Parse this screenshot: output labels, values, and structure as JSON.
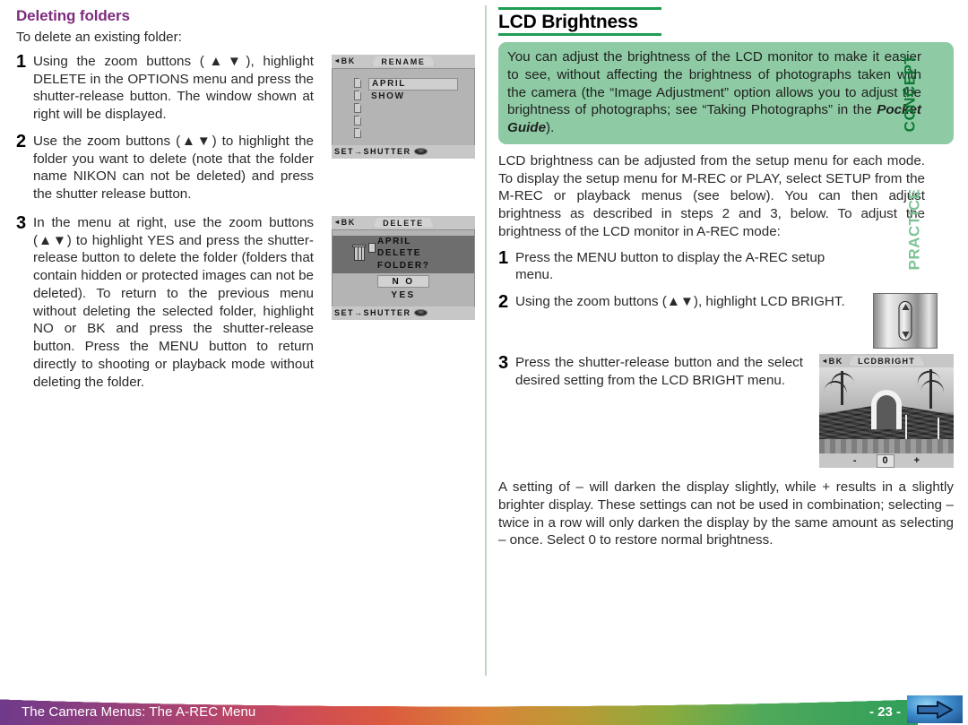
{
  "left_column": {
    "heading": "Deleting folders",
    "intro": "To delete an existing folder:",
    "steps": [
      {
        "num": "1",
        "text": "Using the zoom buttons (▲▼), highlight DELETE in the OPTIONS menu and press the shutter-release button. The window shown at right will be displayed."
      },
      {
        "num": "2",
        "text": "Use the zoom buttons (▲▼) to highlight the folder you want to delete (note that the folder name NIKON can not be deleted) and press the shutter release button."
      },
      {
        "num": "3",
        "text": "In the menu at right, use the zoom buttons (▲▼) to highlight YES and press the shutter-release button to delete the folder (folders that contain hidden or protected images can not be deleted). To return to the previous menu without deleting the selected folder, highlight NO or BK and press the shutter-release button. Press the MENU button to return directly to shooting or playback mode without deleting the folder."
      }
    ]
  },
  "lcd_rename": {
    "bk_label": "BK",
    "tab_title": "RENAME",
    "items": [
      {
        "label": "APRIL",
        "selected": true
      },
      {
        "label": "SHOW",
        "selected": false
      }
    ],
    "folder_icon_count": 5,
    "footer_label": "SET→SHUTTER"
  },
  "lcd_delete": {
    "bk_label": "BK",
    "tab_title": "DELETE",
    "confirm_lines": [
      "APRIL",
      "DELETE",
      "FOLDER?"
    ],
    "options": [
      {
        "label": "N O",
        "selected": true
      },
      {
        "label": "YES",
        "selected": false
      }
    ],
    "footer_label": "SET→SHUTTER"
  },
  "right_column": {
    "heading": "LCD Brightness",
    "concept_box": {
      "tab_label": "CONCEPT",
      "text": "You can adjust the brightness of the LCD monitor to make it easier to see, without affecting the brightness of photographs taken with the camera (the “Image Adjustment” option allows you to adjust the brightness of photographs; see “Taking Photographs” in the ",
      "italic_ref": "Pocket Guide",
      "text_tail": ")."
    },
    "practice": {
      "tab_label": "PRACTICE",
      "intro": "LCD brightness can be adjusted from the setup menu for each mode. To display the setup menu for M-REC or PLAY, select SETUP from the M-REC or playback menus (see below). You can then adjust brightness as described in steps 2 and 3, below. To adjust the brightness of the LCD monitor in A-REC mode:",
      "steps": [
        {
          "num": "1",
          "text": "Press the MENU button to display the A-REC setup menu."
        },
        {
          "num": "2",
          "text": "Using the zoom buttons (▲▼), highlight LCD BRIGHT."
        },
        {
          "num": "3",
          "text": "Press the shutter-release button and the select desired setting from the LCD BRIGHT menu."
        }
      ]
    },
    "closing": "A setting of – will darken the display slightly, while + results in a slightly brighter display. These settings can not be used in combination; selecting – twice in a row will only darken the display by the same amount as selecting – once. Select 0 to restore normal brightness."
  },
  "lcd_bright": {
    "bk_label": "BK",
    "tab_title": "LCDBRIGHT",
    "minus_label": "-",
    "value_label": "0",
    "plus_label": "+"
  },
  "footer": {
    "title": "The Camera Menus: The A-REC Menu",
    "page_number": "- 23 -",
    "nav_icon": "right-arrow-icon"
  },
  "colors": {
    "heading_purple": "#7d2c7d",
    "concept_green": "#8ecba4",
    "rule_green": "#1f9d52",
    "concept_tab": "#0f7a35",
    "practice_tab": "#7fc496"
  }
}
